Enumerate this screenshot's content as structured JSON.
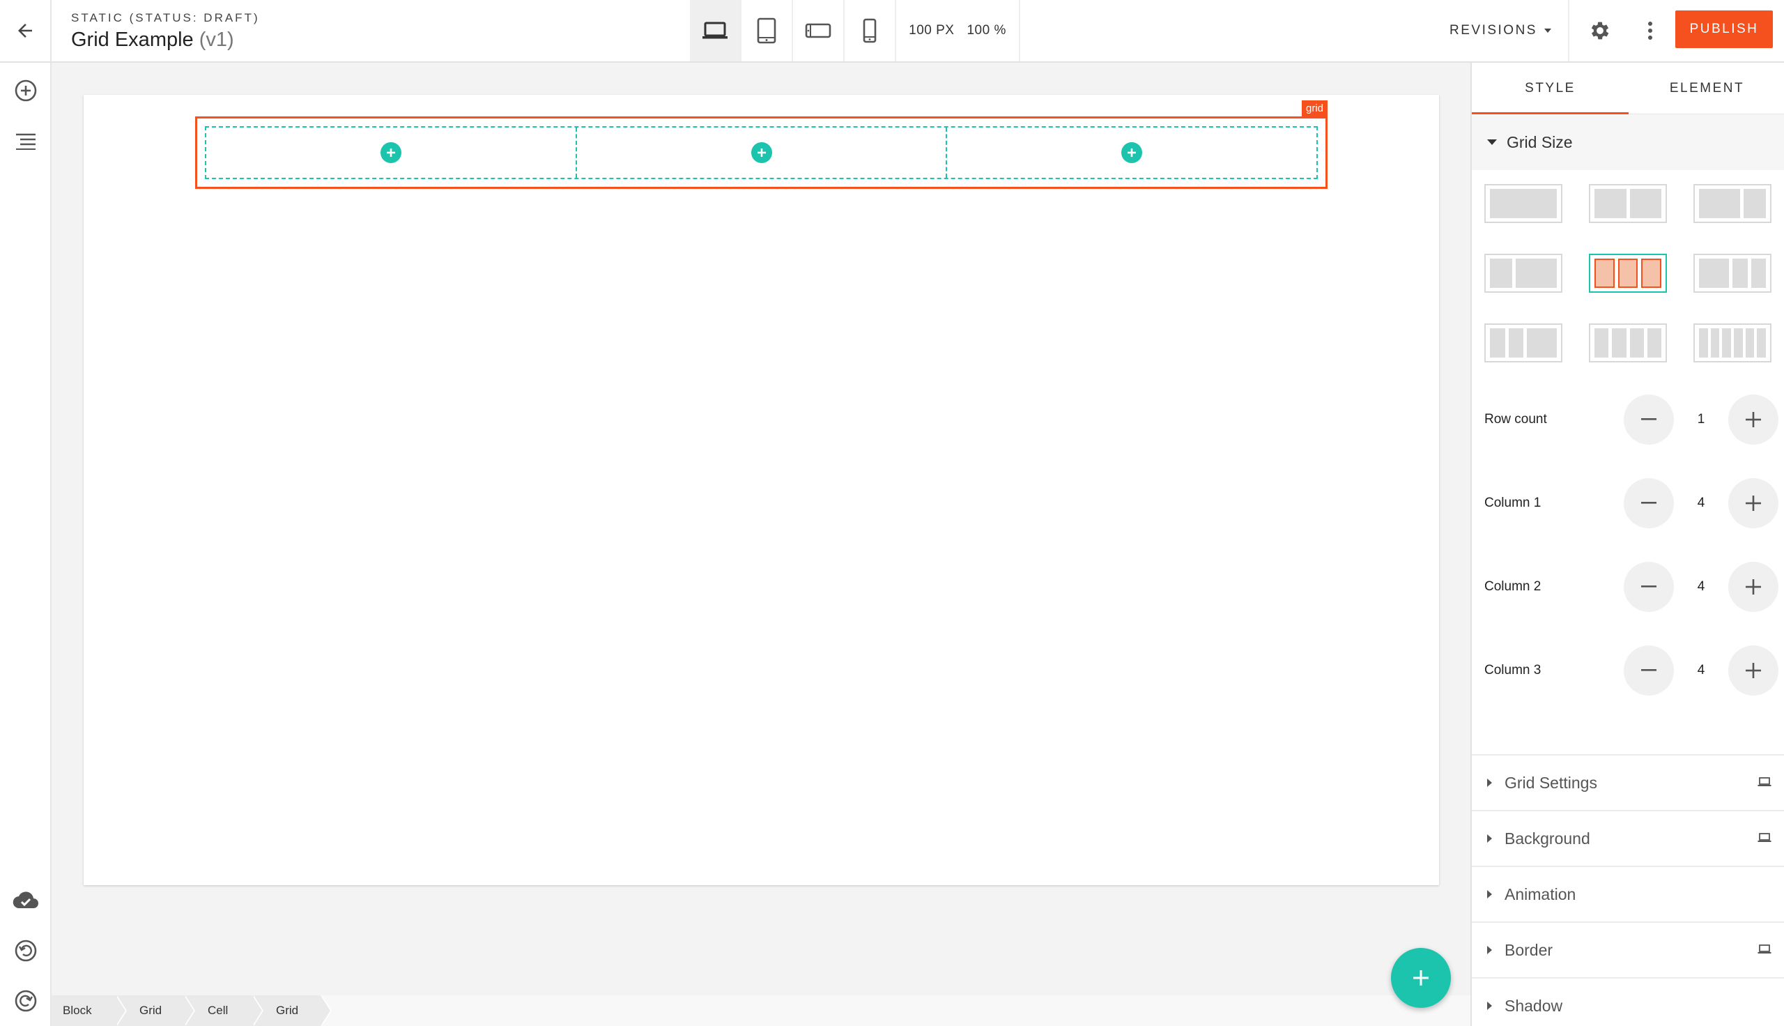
{
  "header": {
    "status": "STATIC (STATUS: DRAFT)",
    "title": "Grid Example",
    "version": "(v1)",
    "zoom_px": "100 PX",
    "zoom_pct": "100 %",
    "revisions_label": "REVISIONS",
    "publish_label": "PUBLISH",
    "devices": [
      "laptop-icon",
      "tablet-icon",
      "tablet-landscape-icon",
      "phone-icon"
    ]
  },
  "canvas": {
    "grid_tag": "grid",
    "cells": 3
  },
  "breadcrumb": [
    "Block",
    "Grid",
    "Cell",
    "Grid"
  ],
  "panel": {
    "tabs": [
      "STYLE",
      "ELEMENT"
    ],
    "active_tab": "STYLE",
    "section_title": "Grid Size",
    "selected_layout": 4,
    "steppers": [
      {
        "label": "Row count",
        "value": "1"
      },
      {
        "label": "Column 1",
        "value": "4"
      },
      {
        "label": "Column 2",
        "value": "4"
      },
      {
        "label": "Column 3",
        "value": "4"
      }
    ],
    "accordion": [
      {
        "label": "Grid Settings",
        "device_icon": true
      },
      {
        "label": "Background",
        "device_icon": true
      },
      {
        "label": "Animation",
        "device_icon": false
      },
      {
        "label": "Border",
        "device_icon": true
      },
      {
        "label": "Shadow",
        "device_icon": false
      }
    ]
  },
  "colors": {
    "accent": "#f4511e",
    "teal": "#1cc4ad"
  }
}
